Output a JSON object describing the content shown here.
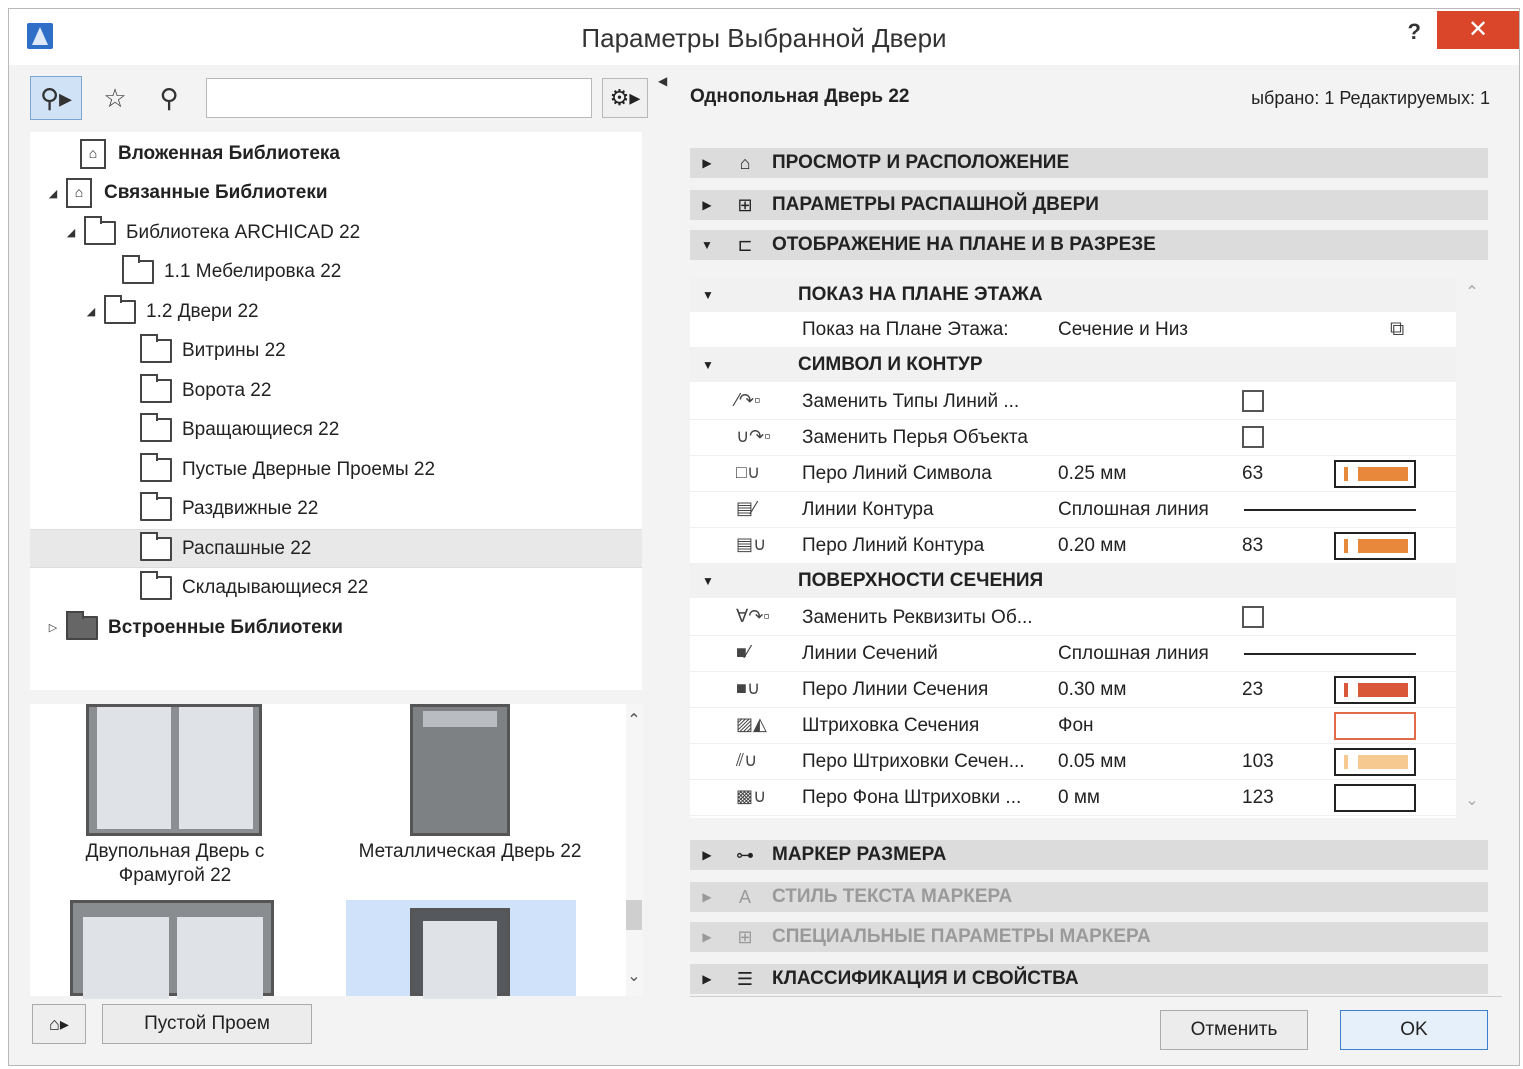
{
  "window": {
    "title": "Параметры Выбранной Двери",
    "help": "?",
    "close": "✕"
  },
  "library": {
    "search_placeholder": "",
    "tree": [
      {
        "label": "Вложенная Библиотека",
        "arrow": "",
        "bold": true
      },
      {
        "label": "Связанные Библиотеки",
        "arrow": "◢",
        "bold": true
      },
      {
        "label": "Библиотека ARCHICAD 22",
        "arrow": "◢",
        "bold": false
      },
      {
        "label": "1.1 Мебелировка 22",
        "arrow": "",
        "bold": false
      },
      {
        "label": "1.2 Двери 22",
        "arrow": "◢",
        "bold": false
      },
      {
        "label": "Витрины 22",
        "arrow": "",
        "bold": false
      },
      {
        "label": "Ворота 22",
        "arrow": "",
        "bold": false
      },
      {
        "label": "Вращающиеся 22",
        "arrow": "",
        "bold": false
      },
      {
        "label": "Пустые Дверные Проемы 22",
        "arrow": "",
        "bold": false
      },
      {
        "label": "Раздвижные 22",
        "arrow": "",
        "bold": false
      },
      {
        "label": "Распашные 22",
        "arrow": "",
        "bold": false,
        "selected": true
      },
      {
        "label": "Складывающиеся 22",
        "arrow": "",
        "bold": false
      },
      {
        "label": "Встроенные Библиотеки",
        "arrow": "▷",
        "bold": true
      }
    ],
    "thumbnails": [
      {
        "caption": "Двупольная Дверь с Фрамугой 22"
      },
      {
        "caption": "Металлическая Дверь 22"
      }
    ],
    "empty_opening_button": "Пустой Проем"
  },
  "panel": {
    "object_name": "Однопольная Дверь 22",
    "selection_info": "ыбрано: 1 Редактируемых: 1",
    "sections_top": [
      {
        "label": "ПРОСМОТР И РАСПОЛОЖЕНИЕ",
        "tri": "▶",
        "icon": "⌂"
      },
      {
        "label": "ПАРАМЕТРЫ РАСПАШНОЙ ДВЕРИ",
        "tri": "▶",
        "icon": "⊞"
      },
      {
        "label": "ОТОБРАЖЕНИЕ НА ПЛАНЕ И В РАЗРЕЗЕ",
        "tri": "▼",
        "icon": "⊏"
      }
    ],
    "groups": {
      "floor_plan": "ПОКАЗ НА ПЛАНЕ ЭТАЖА",
      "symbol": "СИМВОЛ И КОНТУР",
      "cut_surfaces": "ПОВЕРХНОСТИ СЕЧЕНИЯ"
    },
    "rows": {
      "floor_plan_display": {
        "label": "Показ на Плане Этажа:",
        "value": "Сечение и Низ"
      },
      "override_line_types": {
        "label": "Заменить Типы Линий ..."
      },
      "override_object_pens": {
        "label": "Заменить Перья Объекта"
      },
      "symbol_line_pen": {
        "label": "Перо Линий Символа",
        "value": "0.25 мм",
        "pen": "63",
        "color": "#e8883a"
      },
      "outline_lines": {
        "label": "Линии Контура",
        "value": "Сплошная линия"
      },
      "outline_line_pen": {
        "label": "Перо Линий Контура",
        "value": "0.20 мм",
        "pen": "83",
        "color": "#e8883a"
      },
      "override_attributes": {
        "label": "Заменить Реквизиты Об..."
      },
      "cut_lines": {
        "label": "Линии Сечений",
        "value": "Сплошная линия"
      },
      "cut_line_pen": {
        "label": "Перо Линии Сечения",
        "value": "0.30 мм",
        "pen": "23",
        "color": "#d9583a"
      },
      "cut_fill": {
        "label": "Штриховка Сечения",
        "value": "Фон"
      },
      "cut_fill_pen": {
        "label": "Перо Штриховки Сечен...",
        "value": "0.05 мм",
        "pen": "103",
        "color": "#f5c990"
      },
      "cut_fill_bg_pen": {
        "label": "Перо Фона Штриховки ...",
        "value": "0 мм",
        "pen": "123",
        "color": "#ffffff"
      }
    },
    "sections_bottom": [
      {
        "label": "МАРКЕР РАЗМЕРА",
        "tri": "▶",
        "icon": "⊶",
        "disabled": false
      },
      {
        "label": "СТИЛЬ ТЕКСТА МАРКЕРА",
        "tri": "▶",
        "icon": "A",
        "disabled": true
      },
      {
        "label": "СПЕЦИАЛЬНЫЕ ПАРАМЕТРЫ МАРКЕРА",
        "tri": "▶",
        "icon": "⊞",
        "disabled": true
      },
      {
        "label": "КЛАССИФИКАЦИЯ И СВОЙСТВА",
        "tri": "▶",
        "icon": "☰",
        "disabled": false
      }
    ]
  },
  "buttons": {
    "cancel": "Отменить",
    "ok": "OK"
  }
}
